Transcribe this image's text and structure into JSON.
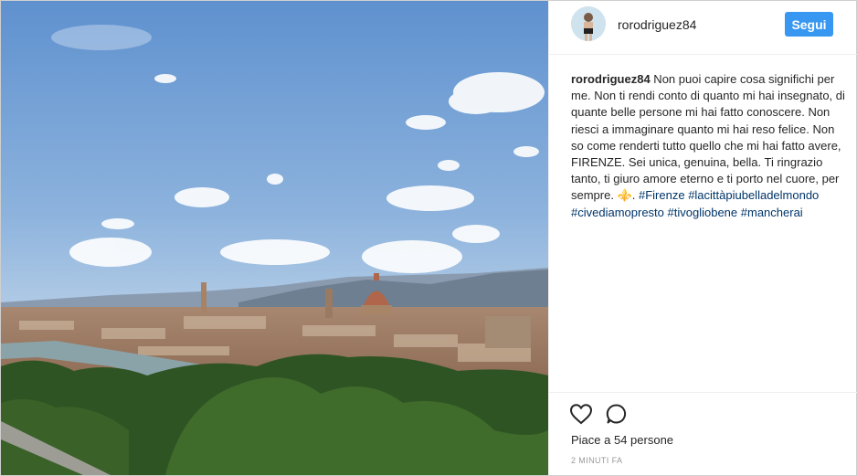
{
  "post": {
    "username": "rorodriguez84",
    "follow_label": "Segui",
    "caption": {
      "author": "rorodriguez84",
      "text": " Non puoi capire cosa significhi per me. Non ti rendi conto di quanto mi hai insegnato, di quante belle persone mi hai fatto conoscere. Non riesci a immaginare quanto mi hai reso felice. Non so come renderti tutto quello che mi hai fatto avere, FIRENZE. Sei unica, genuina, bella. Ti ringrazio tanto, ti giuro amore eterno e ti porto nel cuore, per sempre. ⚜️. ",
      "hashtags": [
        "#Firenze",
        "#lacittàpiubelladelmondo",
        "#civediamopresto",
        "#tivogliobene",
        "#mancherai"
      ]
    },
    "likes_text": "Piace a 54 persone",
    "timestamp": "2 MINUTI FA"
  },
  "icons": {
    "like": "heart-icon",
    "comment": "comment-icon",
    "fleur": "fleur-de-lis-emoji"
  },
  "colors": {
    "accent": "#3897f0",
    "hashtag": "#003569",
    "text": "#262626",
    "muted": "#999999"
  }
}
